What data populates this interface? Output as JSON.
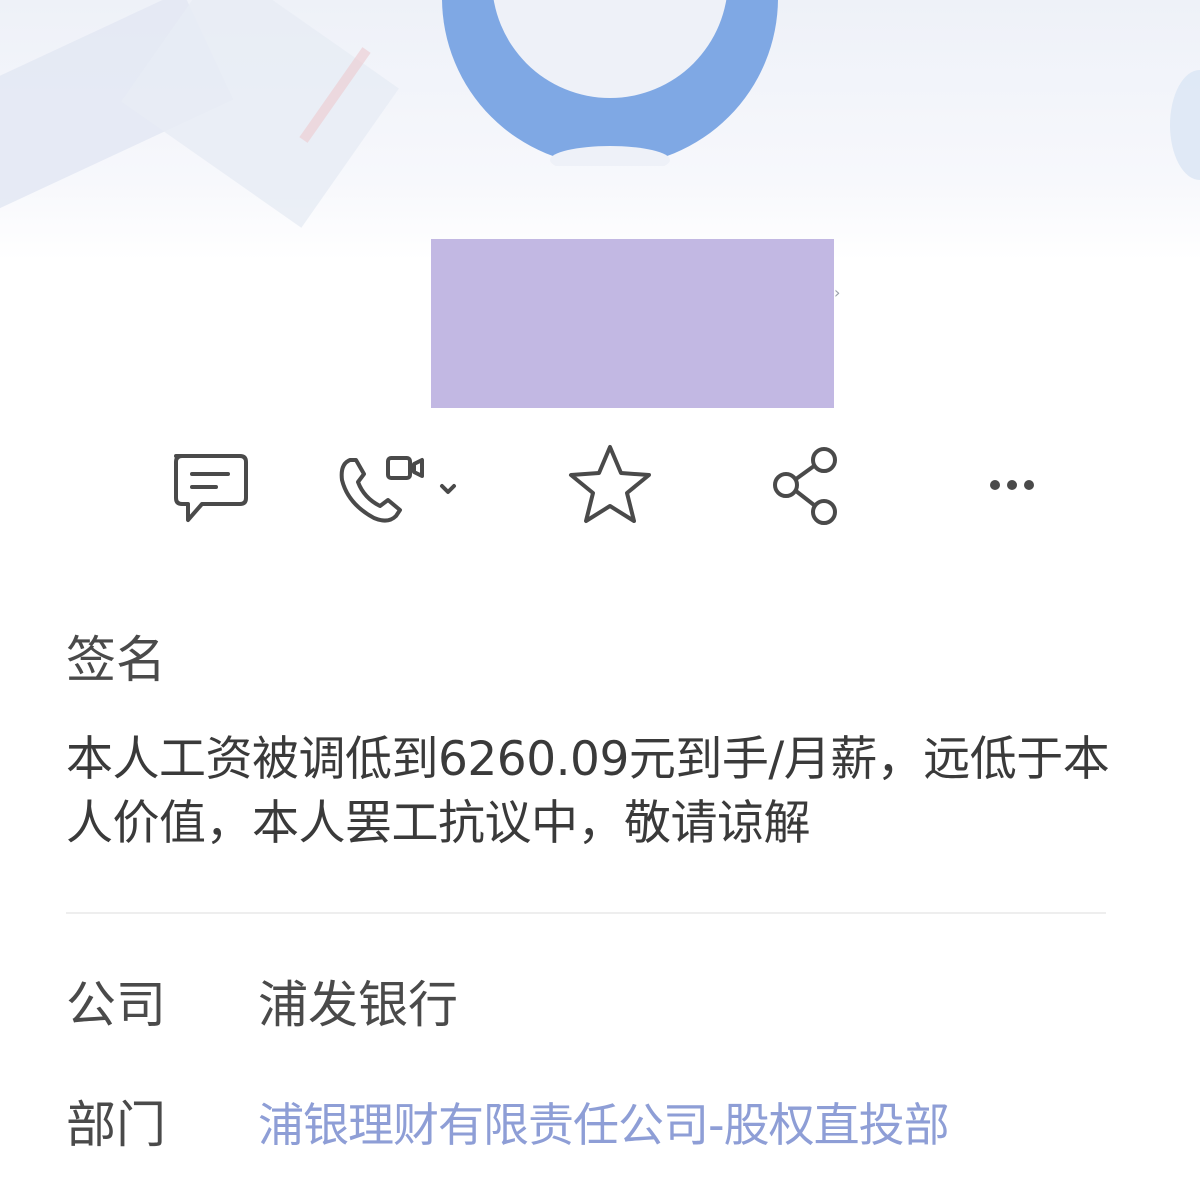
{
  "profile": {
    "signature_label": "签名",
    "signature_text": "本人工资被调低到6260.09元到手/月薪，远低于本人价值，本人罢工抗议中，敬请谅解",
    "company_label": "公司",
    "company_value": "浦发银行",
    "department_label": "部门",
    "department_value": "浦银理财有限责任公司-股权直投部"
  },
  "actions": [
    {
      "icon": "message-icon"
    },
    {
      "icon": "phone-video-icon"
    },
    {
      "icon": "star-icon"
    },
    {
      "icon": "share-icon"
    },
    {
      "icon": "more-icon"
    }
  ],
  "colors": {
    "avatar": "#7fa8e4",
    "name_redaction": "#c2b8e3",
    "department_link": "#8e9ed6",
    "text": "#3a3a3a"
  }
}
